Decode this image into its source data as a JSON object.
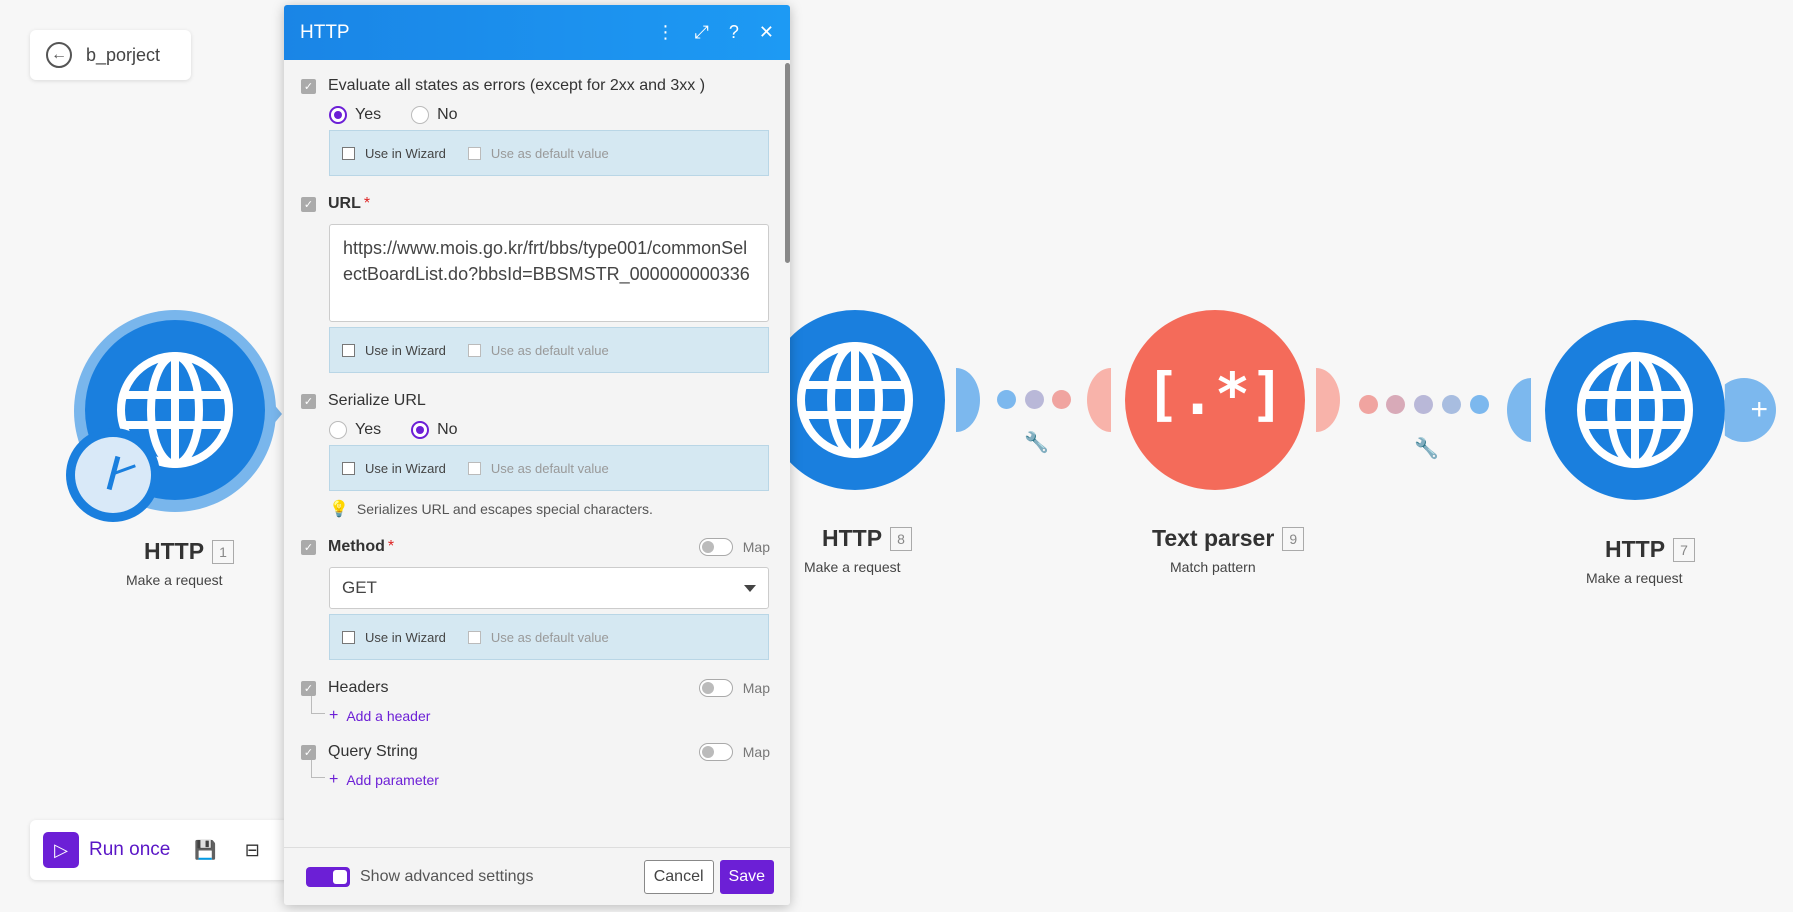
{
  "scenario": {
    "name": "b_porject",
    "back_icon": "arrow-left-circle-icon"
  },
  "canvas": {
    "modules": [
      {
        "title": "HTTP",
        "number": "1",
        "subtitle": "Make a request",
        "color": "#1a7fde",
        "schedule_icon": "clock-icon"
      },
      {
        "title": "HTTP",
        "number": "8",
        "subtitle": "Make a request",
        "color": "#1a7fde"
      },
      {
        "title": "Text parser",
        "number": "9",
        "subtitle": "Match pattern",
        "color": "#f46b5a",
        "glyph": "[.*]"
      },
      {
        "title": "HTTP",
        "number": "7",
        "subtitle": "Make a request",
        "color": "#1a7fde"
      }
    ],
    "add_glyph": "+"
  },
  "runbar": {
    "run_label": "Run once",
    "run_icon": "play-icon",
    "save_icon": "save-icon",
    "scheduling_icon": "scheduling-icon"
  },
  "dialog": {
    "title": "HTTP",
    "header_icons": [
      "more-vertical-icon",
      "expand-icon",
      "help-icon",
      "close-icon"
    ],
    "evaluate": {
      "label": "Evaluate all states as errors (except for 2xx and 3xx )",
      "yes": "Yes",
      "no": "No",
      "selected": "Yes"
    },
    "wizard": {
      "use_in_wizard": "Use in Wizard",
      "use_as_default": "Use as default value"
    },
    "url": {
      "label": "URL",
      "required": "*",
      "value": "https://www.mois.go.kr/frt/bbs/type001/commonSelectBoardList.do?bbsId=BBSMSTR_000000000336"
    },
    "serialize": {
      "label": "Serialize URL",
      "yes": "Yes",
      "no": "No",
      "selected": "No",
      "hint": "Serializes URL and escapes special characters."
    },
    "method": {
      "label": "Method",
      "required": "*",
      "map": "Map",
      "value": "GET"
    },
    "headers": {
      "label": "Headers",
      "map": "Map",
      "add": "Add a header"
    },
    "query": {
      "label": "Query String",
      "map": "Map",
      "add": "Add parameter"
    },
    "footer": {
      "advanced": "Show advanced settings",
      "cancel": "Cancel",
      "save": "Save"
    }
  }
}
